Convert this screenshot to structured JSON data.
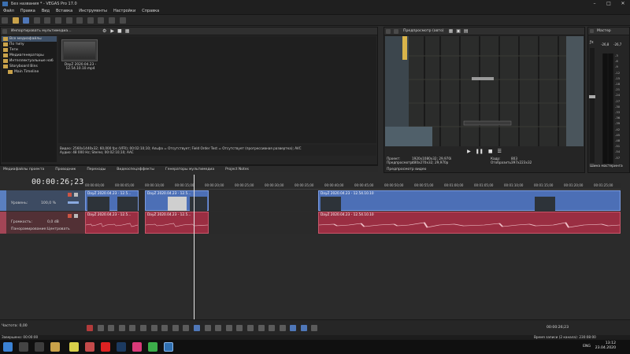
{
  "window": {
    "title": "Без названия * - VEGAS Pro 17.0"
  },
  "menu": [
    "Файл",
    "Правка",
    "Вид",
    "Вставка",
    "Инструменты",
    "Настройки",
    "Справка"
  ],
  "explorer": {
    "dropdown": "Импортировать мультимедиа...",
    "tree": [
      "Все медиафайлы",
      "По типу",
      "Теги",
      "Медиагенераторы",
      "Интеллектуальные наб",
      "Storyboard Bins",
      "Main Timeline"
    ],
    "file_name": "DayZ 2020.04.23 - 12.54.10.10.mp4",
    "info_line1": "Видео: 2560x1440x32; 60,000 fps (VFR); 00:02:10;10; Альфа = Отсутствует; Field Order Test = Отсутствует (прогрессивная развертка); AVC",
    "info_line2": "Аудио: 48 000 Hz; Stereo; 00:02:10;10; AAC",
    "tabs": [
      "Медиафайлы проекта",
      "Проводник",
      "Переходы",
      "Видеоспецэффекты",
      "Генераторы мультимедиа",
      "Project Notes"
    ]
  },
  "preview": {
    "dropdown": "Предпросмотр (авто)",
    "project_label": "Проект:",
    "project_value": "1920x1080x32; 29,970i",
    "preview_label": "Предпросмотр:",
    "preview_value": "480x270x32; 29,970p",
    "frame_label": "Кадр:",
    "frame_value": "803",
    "display_label": "Отобразить:",
    "display_value": "397x223x32",
    "tab": "Предпросмотр видео"
  },
  "master": {
    "title": "Мастер",
    "values": [
      "-26,8",
      "-26,7"
    ],
    "ticks": [
      "-3",
      "-6",
      "-9",
      "-12",
      "-15",
      "-18",
      "-21",
      "-24",
      "-27",
      "-30",
      "-33",
      "-36",
      "-39",
      "-42",
      "-45",
      "-48",
      "-51",
      "-54",
      "-57"
    ],
    "tab": "Шина мастеринга"
  },
  "timeline": {
    "timecode": "00:00:26;23",
    "ruler": [
      "00:00:00;00",
      "00:00:05;00",
      "00:00:10;00",
      "00:00:15;00",
      "00:00:20;00",
      "00:00:25;00",
      "00:00:30;00",
      "00:00:35;00",
      "00:00:40;00",
      "00:00:45;00",
      "00:00:50;00",
      "00:00:55;00",
      "00:01:00;00",
      "00:01:05;00",
      "00:01:10;00",
      "00:01:15;00",
      "00:01:20;00",
      "00:01:25;00"
    ],
    "video_track": {
      "label": "Уровень:",
      "value": "100,0 %"
    },
    "audio_track": {
      "vol_label": "Громкость:",
      "vol_value": "0,0 dB",
      "pan_label": "Панорамирование:",
      "pan_value": "Центровать"
    },
    "clips": {
      "v1": "DayZ 2020.04.23 - 12.5...",
      "v2": "DayZ 2020.04.23 - 12.5...",
      "v3": "DayZ 2020.04.23 - 12.54.10.10",
      "a1": "DayZ 2020.04.23 - 12.5...",
      "a2": "DayZ 2020.04.23 - 12.5...",
      "a3": "DayZ 2020.04.23 - 12.54.10.10"
    }
  },
  "transport": {
    "rate": "Частота: 0,00",
    "timecode": "00:00:26;23"
  },
  "status": {
    "left": "Завершено: 00:00:00",
    "right": "Время записи (2 канала): 230:08:00"
  },
  "taskbar": {
    "lang": "ENG",
    "time": "13:12",
    "date": "23.04.2020"
  }
}
